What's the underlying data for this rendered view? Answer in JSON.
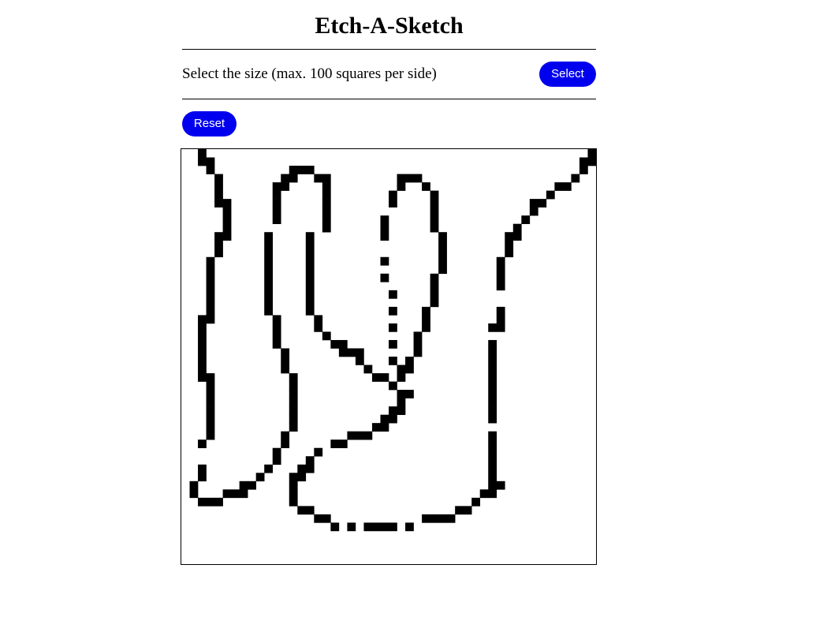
{
  "app": {
    "title": "Etch-A-Sketch"
  },
  "controls": {
    "size_label": "Select the size (max. 100 squares per side)",
    "select_label": "Select",
    "reset_label": "Reset"
  },
  "colors": {
    "button_bg": "#0000ee",
    "button_text": "#ffffff",
    "ink": "#000000",
    "paper": "#ffffff"
  },
  "grid": {
    "squares_per_side": 50,
    "filled_cells": [
      [
        2,
        0
      ],
      [
        2,
        1
      ],
      [
        3,
        1
      ],
      [
        3,
        2
      ],
      [
        4,
        3
      ],
      [
        4,
        4
      ],
      [
        4,
        5
      ],
      [
        4,
        6
      ],
      [
        5,
        6
      ],
      [
        5,
        7
      ],
      [
        5,
        8
      ],
      [
        5,
        9
      ],
      [
        5,
        10
      ],
      [
        4,
        10
      ],
      [
        4,
        11
      ],
      [
        4,
        12
      ],
      [
        3,
        13
      ],
      [
        3,
        14
      ],
      [
        3,
        15
      ],
      [
        3,
        16
      ],
      [
        3,
        17
      ],
      [
        3,
        18
      ],
      [
        3,
        19
      ],
      [
        3,
        20
      ],
      [
        2,
        20
      ],
      [
        2,
        21
      ],
      [
        2,
        22
      ],
      [
        2,
        23
      ],
      [
        2,
        24
      ],
      [
        2,
        25
      ],
      [
        2,
        26
      ],
      [
        2,
        27
      ],
      [
        3,
        27
      ],
      [
        3,
        28
      ],
      [
        3,
        29
      ],
      [
        3,
        30
      ],
      [
        3,
        31
      ],
      [
        3,
        32
      ],
      [
        3,
        33
      ],
      [
        3,
        34
      ],
      [
        2,
        35
      ],
      [
        2,
        38
      ],
      [
        2,
        39
      ],
      [
        1,
        40
      ],
      [
        1,
        41
      ],
      [
        2,
        42
      ],
      [
        3,
        42
      ],
      [
        4,
        42
      ],
      [
        5,
        41
      ],
      [
        6,
        41
      ],
      [
        7,
        41
      ],
      [
        7,
        40
      ],
      [
        8,
        40
      ],
      [
        9,
        39
      ],
      [
        10,
        38
      ],
      [
        11,
        37
      ],
      [
        11,
        36
      ],
      [
        13,
        2
      ],
      [
        14,
        2
      ],
      [
        15,
        2
      ],
      [
        12,
        3
      ],
      [
        13,
        3
      ],
      [
        16,
        3
      ],
      [
        17,
        3
      ],
      [
        11,
        4
      ],
      [
        12,
        4
      ],
      [
        17,
        4
      ],
      [
        11,
        5
      ],
      [
        17,
        5
      ],
      [
        11,
        6
      ],
      [
        17,
        6
      ],
      [
        11,
        7
      ],
      [
        17,
        7
      ],
      [
        11,
        8
      ],
      [
        17,
        8
      ],
      [
        17,
        9
      ],
      [
        10,
        10
      ],
      [
        10,
        11
      ],
      [
        10,
        12
      ],
      [
        10,
        13
      ],
      [
        10,
        14
      ],
      [
        10,
        15
      ],
      [
        10,
        16
      ],
      [
        10,
        17
      ],
      [
        10,
        18
      ],
      [
        10,
        19
      ],
      [
        11,
        20
      ],
      [
        11,
        21
      ],
      [
        11,
        22
      ],
      [
        11,
        23
      ],
      [
        12,
        24
      ],
      [
        12,
        25
      ],
      [
        12,
        26
      ],
      [
        13,
        27
      ],
      [
        13,
        28
      ],
      [
        13,
        29
      ],
      [
        13,
        30
      ],
      [
        13,
        31
      ],
      [
        13,
        32
      ],
      [
        13,
        33
      ],
      [
        12,
        34
      ],
      [
        12,
        35
      ],
      [
        11,
        36
      ],
      [
        15,
        10
      ],
      [
        15,
        11
      ],
      [
        15,
        12
      ],
      [
        15,
        13
      ],
      [
        15,
        14
      ],
      [
        15,
        15
      ],
      [
        15,
        16
      ],
      [
        15,
        17
      ],
      [
        15,
        18
      ],
      [
        15,
        19
      ],
      [
        16,
        20
      ],
      [
        16,
        21
      ],
      [
        17,
        22
      ],
      [
        18,
        23
      ],
      [
        19,
        23
      ],
      [
        19,
        24
      ],
      [
        20,
        24
      ],
      [
        21,
        24
      ],
      [
        21,
        25
      ],
      [
        22,
        26
      ],
      [
        23,
        27
      ],
      [
        24,
        27
      ],
      [
        25,
        28
      ],
      [
        26,
        27
      ],
      [
        26,
        29
      ],
      [
        27,
        29
      ],
      [
        26,
        30
      ],
      [
        25,
        31
      ],
      [
        26,
        31
      ],
      [
        24,
        32
      ],
      [
        25,
        32
      ],
      [
        23,
        33
      ],
      [
        24,
        33
      ],
      [
        22,
        34
      ],
      [
        21,
        34
      ],
      [
        20,
        34
      ],
      [
        19,
        35
      ],
      [
        18,
        35
      ],
      [
        16,
        36
      ],
      [
        15,
        37
      ],
      [
        14,
        38
      ],
      [
        15,
        38
      ],
      [
        13,
        39
      ],
      [
        14,
        39
      ],
      [
        13,
        40
      ],
      [
        13,
        41
      ],
      [
        13,
        42
      ],
      [
        14,
        43
      ],
      [
        15,
        43
      ],
      [
        16,
        44
      ],
      [
        17,
        44
      ],
      [
        18,
        45
      ],
      [
        20,
        45
      ],
      [
        22,
        45
      ],
      [
        23,
        45
      ],
      [
        24,
        45
      ],
      [
        25,
        45
      ],
      [
        27,
        45
      ],
      [
        29,
        44
      ],
      [
        30,
        44
      ],
      [
        31,
        44
      ],
      [
        32,
        44
      ],
      [
        33,
        43
      ],
      [
        34,
        43
      ],
      [
        35,
        42
      ],
      [
        36,
        41
      ],
      [
        37,
        41
      ],
      [
        38,
        40
      ],
      [
        37,
        40
      ],
      [
        37,
        39
      ],
      [
        37,
        38
      ],
      [
        37,
        37
      ],
      [
        37,
        36
      ],
      [
        37,
        35
      ],
      [
        37,
        34
      ],
      [
        37,
        32
      ],
      [
        37,
        31
      ],
      [
        37,
        30
      ],
      [
        37,
        29
      ],
      [
        37,
        28
      ],
      [
        37,
        27
      ],
      [
        37,
        26
      ],
      [
        37,
        25
      ],
      [
        37,
        24
      ],
      [
        37,
        23
      ],
      [
        38,
        21
      ],
      [
        38,
        20
      ],
      [
        38,
        19
      ],
      [
        37,
        21
      ],
      [
        26,
        3
      ],
      [
        27,
        3
      ],
      [
        28,
        3
      ],
      [
        26,
        4
      ],
      [
        29,
        4
      ],
      [
        25,
        5
      ],
      [
        30,
        5
      ],
      [
        25,
        6
      ],
      [
        30,
        6
      ],
      [
        30,
        7
      ],
      [
        24,
        8
      ],
      [
        30,
        8
      ],
      [
        24,
        9
      ],
      [
        30,
        9
      ],
      [
        24,
        10
      ],
      [
        31,
        10
      ],
      [
        31,
        11
      ],
      [
        31,
        12
      ],
      [
        31,
        13
      ],
      [
        31,
        14
      ],
      [
        30,
        15
      ],
      [
        30,
        16
      ],
      [
        30,
        17
      ],
      [
        30,
        18
      ],
      [
        29,
        19
      ],
      [
        29,
        20
      ],
      [
        29,
        21
      ],
      [
        28,
        22
      ],
      [
        28,
        23
      ],
      [
        28,
        24
      ],
      [
        27,
        25
      ],
      [
        27,
        26
      ],
      [
        26,
        26
      ],
      [
        24,
        13
      ],
      [
        24,
        15
      ],
      [
        25,
        17
      ],
      [
        25,
        19
      ],
      [
        25,
        21
      ],
      [
        25,
        23
      ],
      [
        25,
        25
      ],
      [
        38,
        13
      ],
      [
        38,
        14
      ],
      [
        38,
        15
      ],
      [
        38,
        16
      ],
      [
        39,
        10
      ],
      [
        39,
        11
      ],
      [
        39,
        12
      ],
      [
        40,
        9
      ],
      [
        40,
        10
      ],
      [
        41,
        8
      ],
      [
        42,
        7
      ],
      [
        42,
        6
      ],
      [
        43,
        6
      ],
      [
        44,
        5
      ],
      [
        45,
        4
      ],
      [
        46,
        4
      ],
      [
        47,
        3
      ],
      [
        48,
        2
      ],
      [
        49,
        1
      ],
      [
        49,
        0
      ],
      [
        48,
        1
      ]
    ]
  }
}
